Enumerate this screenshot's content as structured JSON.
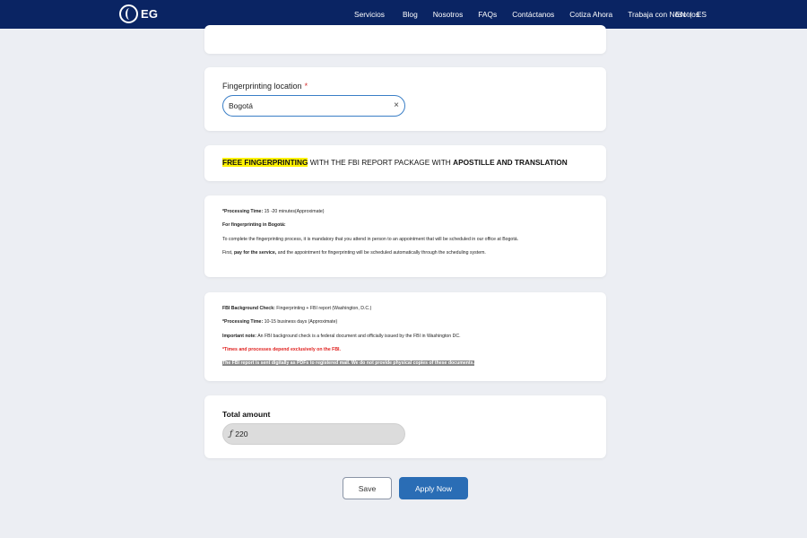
{
  "nav": {
    "logo_text": "EG",
    "links": [
      "Servicios",
      "Blog",
      "Nosotros",
      "FAQs",
      "Contáctanos",
      "Cotiza Ahora",
      "Trabaja con Nosotros"
    ],
    "lang_en": "EN",
    "lang_sep": "|",
    "lang_es": "ES",
    "bg_color": "#0a2463"
  },
  "location": {
    "label": "Fingerprinting location",
    "required_mark": "*",
    "value": "Bogotá",
    "clear_icon": "close-icon"
  },
  "promo": {
    "highlight": "FREE FINGERPRINTING",
    "middle": " WITH THE FBI REPORT PACKAGE WITH ",
    "bold_end": "APOSTILLE AND TRANSLATION"
  },
  "processing": {
    "line1_label": "*Processing Time:",
    "line1_text": " 15 -20 minutes(Approximate)",
    "line2": "For fingerprinting in Bogotá:",
    "line3": "To complete the fingerprinting process, it is mandatory that you attend in person to an appointment that will be scheduled in our office at Bogotá.",
    "line4_pre": "First, ",
    "line4_bold": "pay for the service,",
    "line4_post": " and the appointment for fingerprinting will be scheduled automatically through the scheduling system."
  },
  "fbi": {
    "line1_label": "FBI Background Check:",
    "line1_text": " Fingerprinting + FBI report (Washington, D.C.)",
    "line2_label": "*Processing Time:",
    "line2_text": " 10-15 business days (Approximate)",
    "line3_label": "Important note:",
    "line3_text": " An FBI background check is a federal document and officially issued by the FBI in Washington DC.",
    "line4": "*Times and processes depend exclusively on the FBI.",
    "line5": "The FBI report is sent digitally as PDFs to registered mail. We do not provide physical copies of these documents."
  },
  "total": {
    "label": "Total amount",
    "currency_symbol": "ƒ",
    "amount": "220"
  },
  "actions": {
    "save_label": "Save",
    "apply_label": "Apply Now",
    "apply_color": "#2a6db5"
  }
}
